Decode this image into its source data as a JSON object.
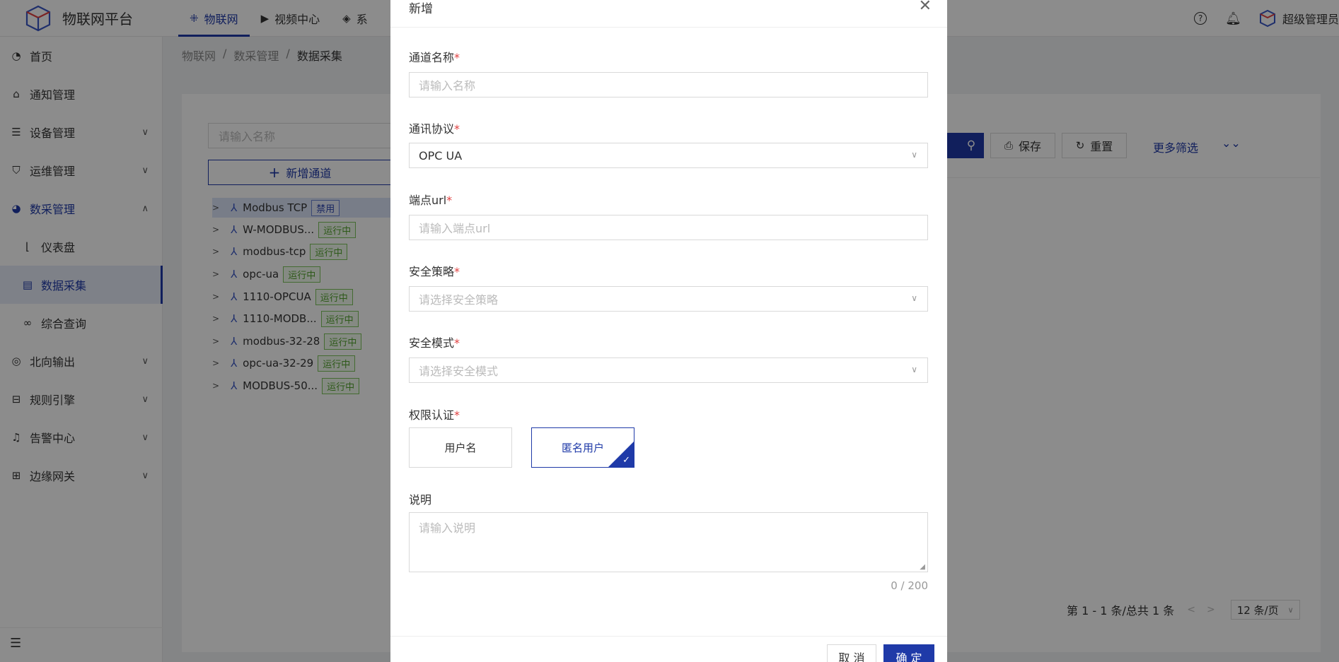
{
  "app": {
    "title": "物联网平台"
  },
  "topnav": [
    {
      "label": "物联网",
      "icon": "iot-icon",
      "active": true
    },
    {
      "label": "视频中心",
      "icon": "video-icon"
    },
    {
      "label": "系",
      "icon": "cube-icon"
    }
  ],
  "header": {
    "username": "超级管理员"
  },
  "sidebar": {
    "items": [
      {
        "label": "首页",
        "icon": "dashboard-icon"
      },
      {
        "label": "通知管理",
        "icon": "notice-icon"
      },
      {
        "label": "设备管理",
        "icon": "device-icon",
        "expandable": true
      },
      {
        "label": "运维管理",
        "icon": "shield-icon",
        "expandable": true
      },
      {
        "label": "数采管理",
        "icon": "pie-icon",
        "expandable": true,
        "open": true
      },
      {
        "label": "仪表盘",
        "icon": "chart-icon",
        "sub": true
      },
      {
        "label": "数据采集",
        "icon": "doc-icon",
        "sub": true,
        "active": true
      },
      {
        "label": "综合查询",
        "icon": "link-icon",
        "sub": true
      },
      {
        "label": "北向输出",
        "icon": "output-icon",
        "expandable": true
      },
      {
        "label": "规则引擎",
        "icon": "rule-icon",
        "expandable": true
      },
      {
        "label": "告警中心",
        "icon": "bell-icon",
        "expandable": true
      },
      {
        "label": "边缘网关",
        "icon": "gateway-icon",
        "expandable": true
      }
    ]
  },
  "breadcrumb": [
    "物联网",
    "/",
    "数采管理",
    "/",
    "数据采集"
  ],
  "tree": {
    "search_placeholder": "请输入名称",
    "new_button": "新增通道",
    "channels": [
      {
        "name": "Modbus TCP",
        "status": "禁用",
        "selected": true
      },
      {
        "name": "W-MODBUS...",
        "status": "运行中"
      },
      {
        "name": "modbus-tcp",
        "status": "运行中"
      },
      {
        "name": "opc-ua",
        "status": "运行中"
      },
      {
        "name": "1110-OPCUA",
        "status": "运行中"
      },
      {
        "name": "1110-MODB...",
        "status": "运行中"
      },
      {
        "name": "modbus-32-28",
        "status": "运行中"
      },
      {
        "name": "opc-ua-32-29",
        "status": "运行中"
      },
      {
        "name": "MODBUS-50...",
        "status": "运行中"
      }
    ]
  },
  "toolbar": {
    "save": "保存",
    "reset": "重置",
    "more_filter": "更多筛选"
  },
  "pagination": {
    "summary": "第 1 - 1 条/总共 1 条",
    "page_size": "12 条/页"
  },
  "modal": {
    "title": "新增",
    "fields": {
      "channel_name": {
        "label": "通道名称",
        "placeholder": "请输入名称"
      },
      "protocol": {
        "label": "通讯协议",
        "value": "OPC UA"
      },
      "endpoint": {
        "label": "端点url",
        "placeholder": "请输入端点url"
      },
      "security_policy": {
        "label": "安全策略",
        "placeholder": "请选择安全策略"
      },
      "security_mode": {
        "label": "安全模式",
        "placeholder": "请选择安全模式"
      },
      "auth": {
        "label": "权限认证",
        "options": [
          "用户名",
          "匿名用户"
        ],
        "selected": "匿名用户"
      },
      "description": {
        "label": "说明",
        "placeholder": "请输入说明",
        "counter": "0 / 200"
      }
    },
    "cancel": "取 消",
    "ok": "确 定"
  },
  "colors": {
    "primary": "#1f3aa8",
    "success": "#52a32e",
    "required": "#e04040"
  }
}
